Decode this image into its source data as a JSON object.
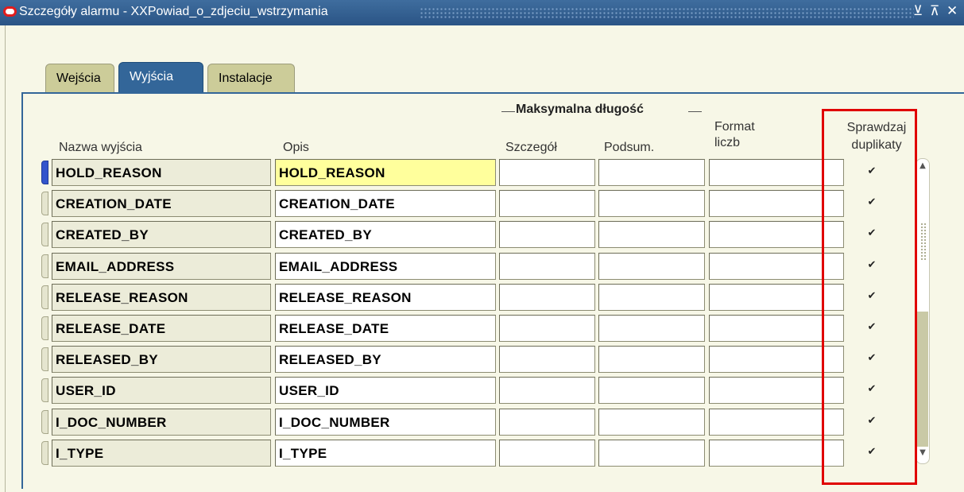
{
  "window": {
    "title": "Szczegóły alarmu - XXPowiad_o_zdjeciu_wstrzymania",
    "buttons": {
      "minimize": "⊻",
      "maximize": "⊼",
      "close": "✕"
    }
  },
  "tabs": [
    {
      "label": "Wejścia",
      "active": false
    },
    {
      "label": "Wyjścia",
      "active": true
    },
    {
      "label": "Instalacje",
      "active": false
    }
  ],
  "columns": {
    "name": "Nazwa wyjścia",
    "description": "Opis",
    "group_label": "Maksymalna długość",
    "detail": "Szczegół",
    "summary": "Podsum.",
    "number_format": "Format\nliczb",
    "check_duplicates": "Sprawdzaj\nduplikaty"
  },
  "rows": [
    {
      "name": "HOLD_REASON",
      "description": "HOLD_REASON",
      "detail": "",
      "summary": "",
      "number_format": "",
      "check_duplicates": true
    },
    {
      "name": "CREATION_DATE",
      "description": "CREATION_DATE",
      "detail": "",
      "summary": "",
      "number_format": "",
      "check_duplicates": true
    },
    {
      "name": "CREATED_BY",
      "description": "CREATED_BY",
      "detail": "",
      "summary": "",
      "number_format": "",
      "check_duplicates": true
    },
    {
      "name": "EMAIL_ADDRESS",
      "description": "EMAIL_ADDRESS",
      "detail": "",
      "summary": "",
      "number_format": "",
      "check_duplicates": true
    },
    {
      "name": "RELEASE_REASON",
      "description": "RELEASE_REASON",
      "detail": "",
      "summary": "",
      "number_format": "",
      "check_duplicates": true
    },
    {
      "name": "RELEASE_DATE",
      "description": "RELEASE_DATE",
      "detail": "",
      "summary": "",
      "number_format": "",
      "check_duplicates": true
    },
    {
      "name": "RELEASED_BY",
      "description": "RELEASED_BY",
      "detail": "",
      "summary": "",
      "number_format": "",
      "check_duplicates": true
    },
    {
      "name": "USER_ID",
      "description": "USER_ID",
      "detail": "",
      "summary": "",
      "number_format": "",
      "check_duplicates": true
    },
    {
      "name": "I_DOC_NUMBER",
      "description": "I_DOC_NUMBER",
      "detail": "",
      "summary": "",
      "number_format": "",
      "check_duplicates": true
    },
    {
      "name": "I_TYPE",
      "description": "I_TYPE",
      "detail": "",
      "summary": "",
      "number_format": "",
      "check_duplicates": true
    }
  ],
  "current_row": 0,
  "colors": {
    "title_bar": "#336699",
    "panel_background": "#f7f7e7",
    "focus_field": "#ffff9c",
    "highlight_box": "#e00000"
  },
  "icons": {
    "app_logo": "oracle-logo-icon",
    "checkbox_checked": "✔"
  }
}
